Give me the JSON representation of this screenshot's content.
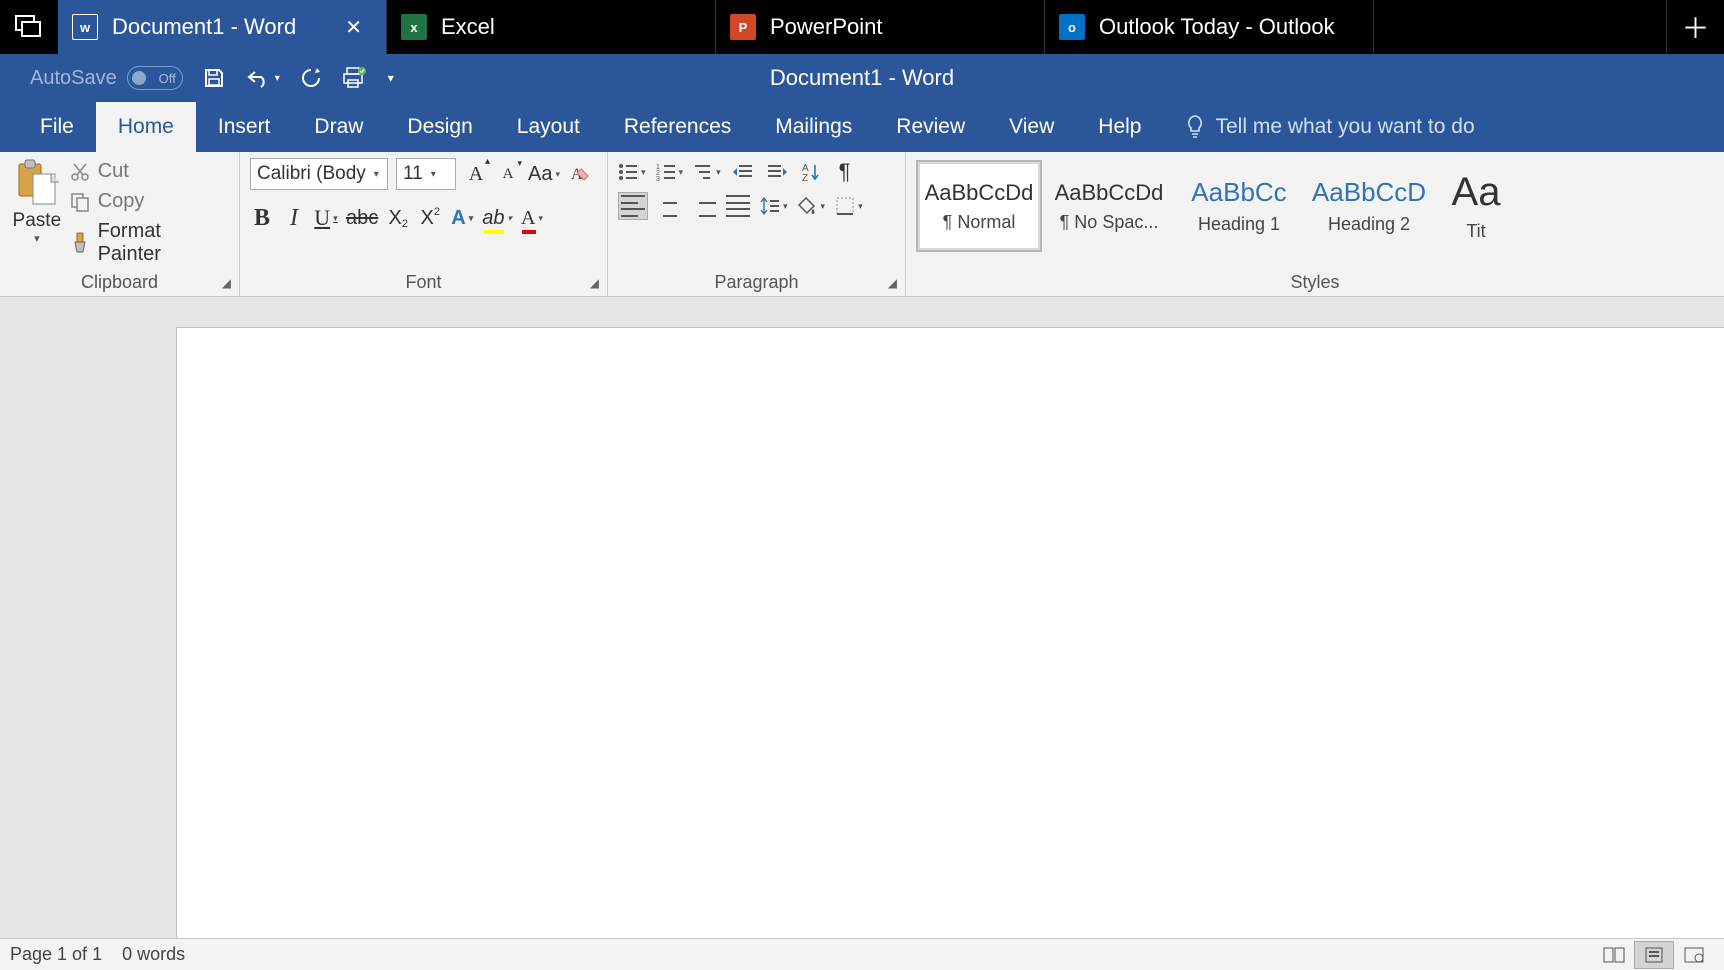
{
  "tabs": [
    {
      "label": "Document1 - Word",
      "app": "word"
    },
    {
      "label": "Excel",
      "app": "excel"
    },
    {
      "label": "PowerPoint",
      "app": "ppt"
    },
    {
      "label": "Outlook Today - Outlook",
      "app": "outlook"
    }
  ],
  "titlebar": {
    "autosave_label": "AutoSave",
    "autosave_state": "Off",
    "doc_title": "Document1  -  Word"
  },
  "ribbon_tabs": [
    "File",
    "Home",
    "Insert",
    "Draw",
    "Design",
    "Layout",
    "References",
    "Mailings",
    "Review",
    "View",
    "Help"
  ],
  "tellme_placeholder": "Tell me what you want to do",
  "clipboard": {
    "paste": "Paste",
    "cut": "Cut",
    "copy": "Copy",
    "format_painter": "Format Painter",
    "group_label": "Clipboard"
  },
  "font": {
    "family": "Calibri (Body",
    "size": "11",
    "group_label": "Font"
  },
  "paragraph": {
    "group_label": "Paragraph"
  },
  "styles": {
    "group_label": "Styles",
    "items": [
      {
        "preview": "AaBbCcDd",
        "name": "¶ Normal",
        "class": ""
      },
      {
        "preview": "AaBbCcDd",
        "name": "¶ No Spac...",
        "class": ""
      },
      {
        "preview": "AaBbCc",
        "name": "Heading 1",
        "class": "blue"
      },
      {
        "preview": "AaBbCcD",
        "name": "Heading 2",
        "class": "blue"
      },
      {
        "preview": "Aa",
        "name": "Tit",
        "class": "big"
      }
    ]
  },
  "status": {
    "page": "Page 1 of 1",
    "words": "0 words"
  }
}
